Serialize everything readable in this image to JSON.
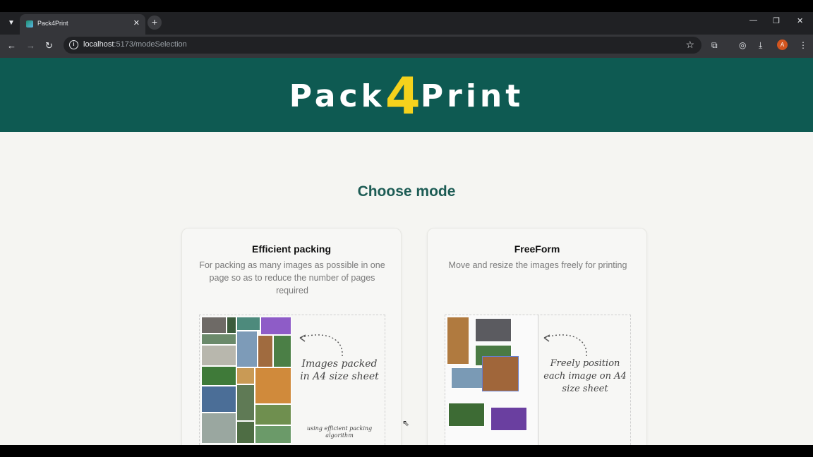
{
  "browser": {
    "tab_title": "Pack4Print",
    "url_host": "localhost",
    "url_path": ":5173/modeSelection",
    "profile_initial": "A"
  },
  "header": {
    "logo_pre": "Pack",
    "logo_num": "4",
    "logo_post": "Print"
  },
  "main": {
    "heading": "Choose mode",
    "cards": [
      {
        "title": "Efficient packing",
        "description": "For packing as many images as possible in one page so as to reduce the number of pages required",
        "annotation": "Images packed in A4 size sheet",
        "footnote": "using efficient packing algorithm"
      },
      {
        "title": "FreeForm",
        "description": "Move and resize the images freely for printing",
        "annotation": "Freely position each image on A4 size sheet"
      }
    ]
  },
  "colors": {
    "header": "#0e5a52",
    "accent": "#f5d21c",
    "heading": "#1d5c55"
  }
}
